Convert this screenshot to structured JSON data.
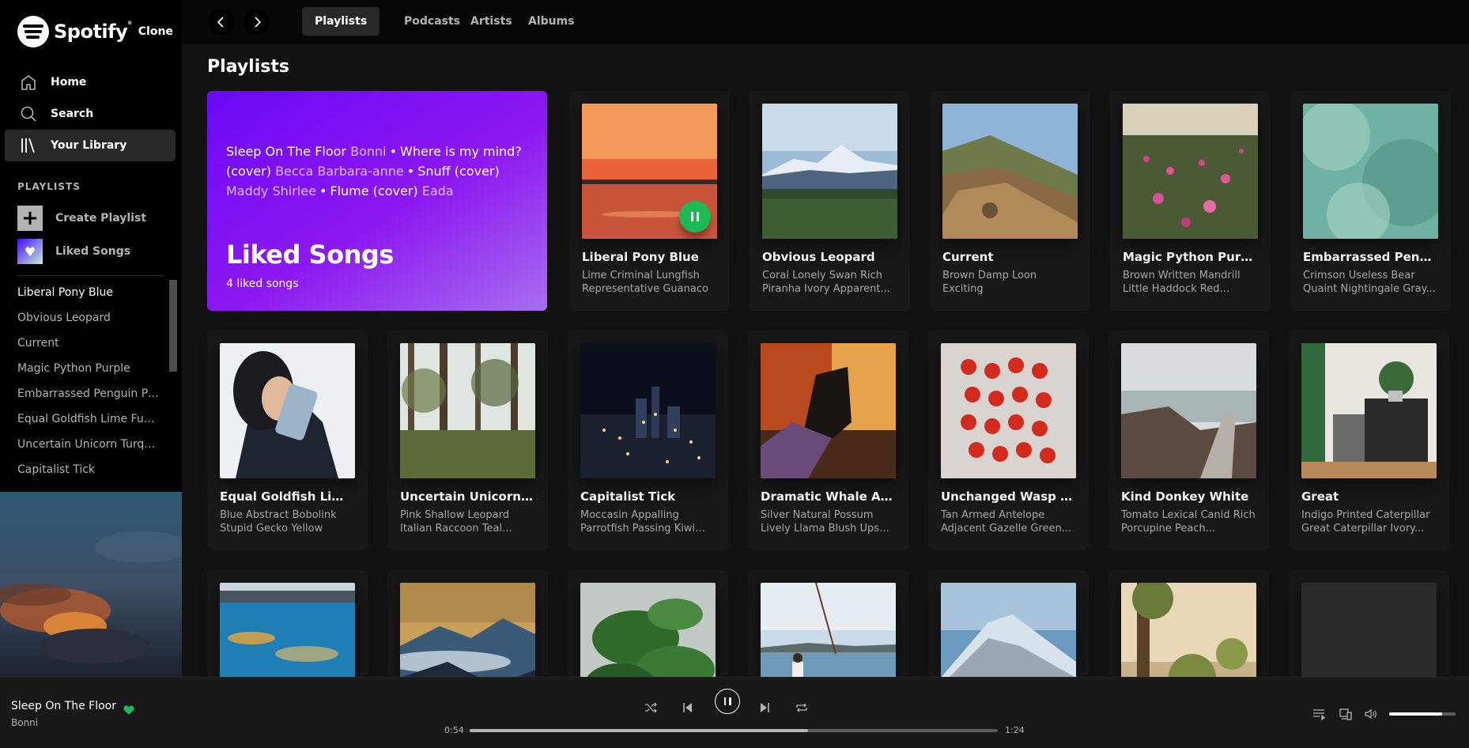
{
  "brand": {
    "name": "Spotify",
    "reg": "®",
    "suffix": "Clone"
  },
  "nav": {
    "home": "Home",
    "search": "Search",
    "library": "Your Library"
  },
  "sidebar": {
    "section_title": "PLAYLISTS",
    "create_playlist": "Create Playlist",
    "liked_songs": "Liked Songs",
    "playlists": [
      "Liberal Pony Blue",
      "Obvious Leopard",
      "Current",
      "Magic Python Purple",
      "Embarrassed Penguin Pe...",
      "Equal Goldfish Lime Fund...",
      "Uncertain Unicorn Turqu...",
      "Capitalist Tick"
    ]
  },
  "topbar": {
    "tabs": [
      "Playlists",
      "Podcasts",
      "Artists",
      "Albums"
    ],
    "active_tab": "Playlists"
  },
  "main": {
    "title": "Playlists",
    "liked": {
      "preview": [
        {
          "song": "Sleep On The Floor",
          "artist": "Bonni"
        },
        {
          "song": "Where is my mind? (cover)",
          "artist": "Becca Barbara-anne"
        },
        {
          "song": "Snuff (cover)",
          "artist": "Maddy Shirlee"
        },
        {
          "song": "Flume (cover)",
          "artist": "Eada"
        }
      ],
      "title": "Liked Songs",
      "count": "4 liked songs"
    },
    "cards": [
      {
        "name": "Liberal Pony Blue",
        "desc": "Lime Criminal Lungfish Representative Guanaco",
        "art": "sunset-lake",
        "playing": true
      },
      {
        "name": "Obvious Leopard",
        "desc": "Coral Lonely Swan Rich Piranha Ivory Apparent...",
        "art": "mountain-plain"
      },
      {
        "name": "Current",
        "desc": "Brown Damp Loon Exciting",
        "art": "rocky-hill"
      },
      {
        "name": "Magic Python Purple",
        "desc": "Brown Written Mandrill Little Haddock Red Mode...",
        "art": "flower-field"
      },
      {
        "name": "Embarrassed Penguin ...",
        "desc": "Crimson Useless Bear Quaint Nightingale Gray...",
        "art": "green-mist"
      },
      {
        "name": "Equal Goldfish Lime Fu...",
        "desc": "Blue Abstract Bobolink Stupid Gecko Yellow",
        "art": "woman-phone"
      },
      {
        "name": "Uncertain Unicorn Tur...",
        "desc": "Pink Shallow Leopard Italian Raccoon Teal Provincial...",
        "art": "forest"
      },
      {
        "name": "Capitalist Tick",
        "desc": "Moccasin Appalling Parrotfish Passing Kiwi Li...",
        "art": "city-night"
      },
      {
        "name": "Dramatic Whale Amber",
        "desc": "Silver Natural Possum Lively Llama Blush Upset Valid...",
        "art": "boots"
      },
      {
        "name": "Unchanged Wasp Coffee",
        "desc": "Tan Armed Antelope Adjacent Gazelle Green...",
        "art": "tomatoes"
      },
      {
        "name": "Kind Donkey White",
        "desc": "Tomato Lexical Canid Rich Porcupine Peach...",
        "art": "boardwalk"
      },
      {
        "name": "Great",
        "desc": "Indigo Printed Caterpillar Great Caterpillar Ivory...",
        "art": "interior-plants"
      },
      {
        "name": "",
        "desc": "",
        "art": "city-reflection"
      },
      {
        "name": "",
        "desc": "",
        "art": "mountain-clouds"
      },
      {
        "name": "",
        "desc": "",
        "art": "leaves"
      },
      {
        "name": "",
        "desc": "",
        "art": "fishing-beach"
      },
      {
        "name": "",
        "desc": "",
        "art": "snowy-mountain"
      },
      {
        "name": "",
        "desc": "",
        "art": "pine-sunset"
      },
      {
        "name": "",
        "desc": "",
        "art": "blank"
      }
    ]
  },
  "player": {
    "title": "Sleep On The Floor",
    "artist": "Bonni",
    "elapsed": "0:54",
    "duration": "1:24",
    "progress": 0.64,
    "volume": 0.8,
    "liked": true,
    "accent": "#1db954"
  }
}
